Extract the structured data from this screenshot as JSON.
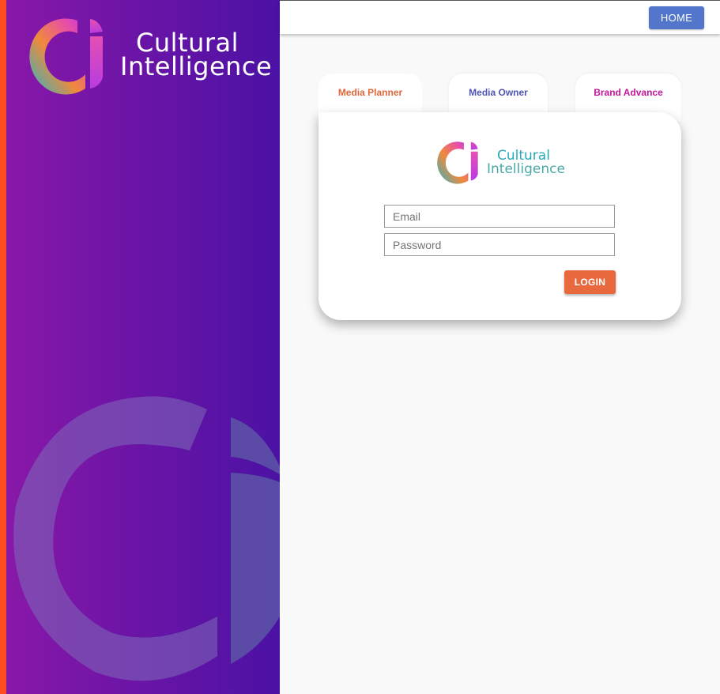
{
  "brand": {
    "name_line1": "Cultural",
    "name_line2": "Intelligence"
  },
  "topbar": {
    "home_label": "HOME"
  },
  "tabs": [
    {
      "label": "Media Planner",
      "color": "#e2673a",
      "active": true
    },
    {
      "label": "Media Owner",
      "color": "#4f55b5",
      "active": false
    },
    {
      "label": "Brand Advance",
      "color": "#c2179b",
      "active": false
    }
  ],
  "login": {
    "email_placeholder": "Email",
    "password_placeholder": "Password",
    "submit_label": "LOGIN"
  },
  "colors": {
    "accent_strip": "#ff4d1f",
    "panel_gradient_start": "#8a18a8",
    "panel_gradient_end": "#4b12a4",
    "home_button": "#5276cc",
    "login_button": "#e8693e"
  }
}
